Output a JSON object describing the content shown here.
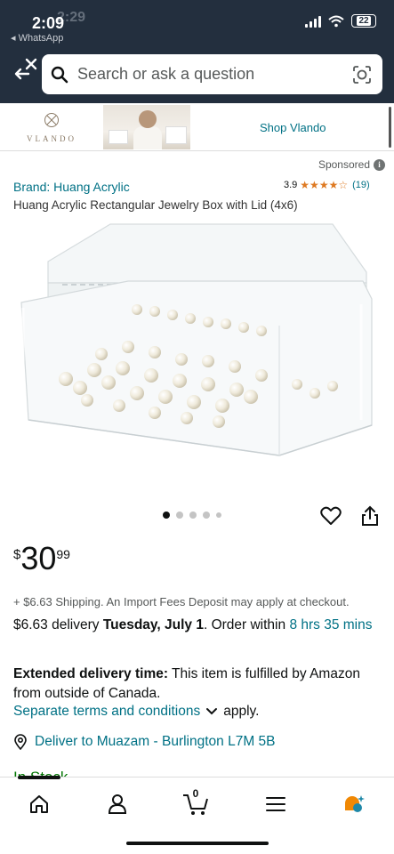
{
  "status_bar": {
    "time": "2:09",
    "ghost_time": "2:29",
    "back_app": "◂ WhatsApp",
    "battery": "22"
  },
  "search": {
    "placeholder": "Search or ask a question"
  },
  "banner": {
    "logo_text": "VLANDO",
    "shop_link": "Shop Vlando"
  },
  "sponsored": {
    "label": "Sponsored",
    "info_glyph": "i"
  },
  "product": {
    "brand": "Brand: Huang Acrylic",
    "rating_value": "3.9",
    "rating_stars": "★★★★☆",
    "rating_count": "(19)",
    "title": "Huang Acrylic Rectangular Jewelry Box with Lid (4x6)"
  },
  "gallery": {
    "total_images": 5,
    "active_index": 0
  },
  "price": {
    "currency": "$",
    "whole": "30",
    "fraction": "99"
  },
  "shipping": {
    "line": "+ $6.63 Shipping. An Import Fees Deposit may apply at checkout.",
    "delivery_prefix": "$6.63 delivery ",
    "delivery_date": "Tuesday, July 1",
    "order_within_prefix": ". Order within ",
    "order_within_time": "8 hrs 35 mins"
  },
  "extended": {
    "label": "Extended delivery time:",
    "text": " This item is fulfilled by Amazon from outside of Canada."
  },
  "terms": {
    "link": "Separate terms and conditions",
    "suffix": "apply."
  },
  "deliver_to": {
    "text": "Deliver to Muazam - Burlington L7M 5B"
  },
  "stock": {
    "text": "In Stock"
  },
  "bottom_nav": {
    "cart_count": "0"
  },
  "colors": {
    "header_bg": "#232f3e",
    "link": "#007185",
    "star": "#de7921",
    "stock": "#007600"
  }
}
